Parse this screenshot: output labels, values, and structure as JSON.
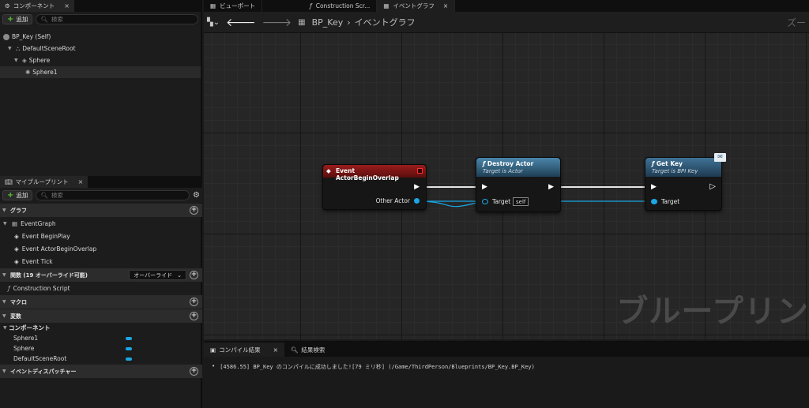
{
  "components_panel": {
    "tab_label": "コンポーネント",
    "add_label": "追加",
    "search_placeholder": "検索",
    "tree": [
      "BP_Key (Self)",
      "DefaultSceneRoot",
      "Sphere",
      "Sphere1"
    ]
  },
  "blueprint_panel": {
    "tab_label": "マイブループリント",
    "add_label": "追加",
    "search_placeholder": "検索",
    "graph_section": "グラフ",
    "event_graph": "EventGraph",
    "events": [
      "Event BeginPlay",
      "Event ActorBeginOverlap",
      "Event Tick"
    ],
    "functions_section": "関数 (19 オーバーライド可能)",
    "override_label": "オーバーライド",
    "construction_script": "Construction Script",
    "macros_section": "マクロ",
    "variables_section": "変数",
    "components_subsection": "コンポーネント",
    "component_vars": [
      "Sphere1",
      "Sphere",
      "DefaultSceneRoot"
    ],
    "dispatchers_section": "イベントディスパッチャー"
  },
  "editor_tabs": [
    "ビューポート",
    "Construction Scr...",
    "イベントグラフ"
  ],
  "breadcrumb": {
    "blueprint": "BP_Key",
    "graph": "イベントグラフ"
  },
  "zoom_label": "ズー",
  "graph_watermark": "ブループリン",
  "nodes": {
    "event": {
      "title": "Event ActorBeginOverlap",
      "pin_other_actor": "Other Actor"
    },
    "destroy": {
      "title": "Destroy Actor",
      "subtitle": "Target is Actor",
      "pin_target": "Target",
      "target_value": "self"
    },
    "getkey": {
      "title": "Get Key",
      "subtitle": "Target is BPI Key",
      "pin_target": "Target"
    }
  },
  "bottom_tabs": [
    "コンパイル結果",
    "結果検索"
  ],
  "log": {
    "bullet": "•",
    "message": "[4586.55] BP_Key のコンパイルに成功しました![79 ミリ秒] (/Game/ThirdPerson/Blueprints/BP_Key.BP_Key)"
  },
  "colors": {
    "event_header": "#8a1a1a",
    "function_header": "#3b6a8a",
    "interface_header": "#3b5f7a",
    "object_pin": "#1aa7e6"
  }
}
